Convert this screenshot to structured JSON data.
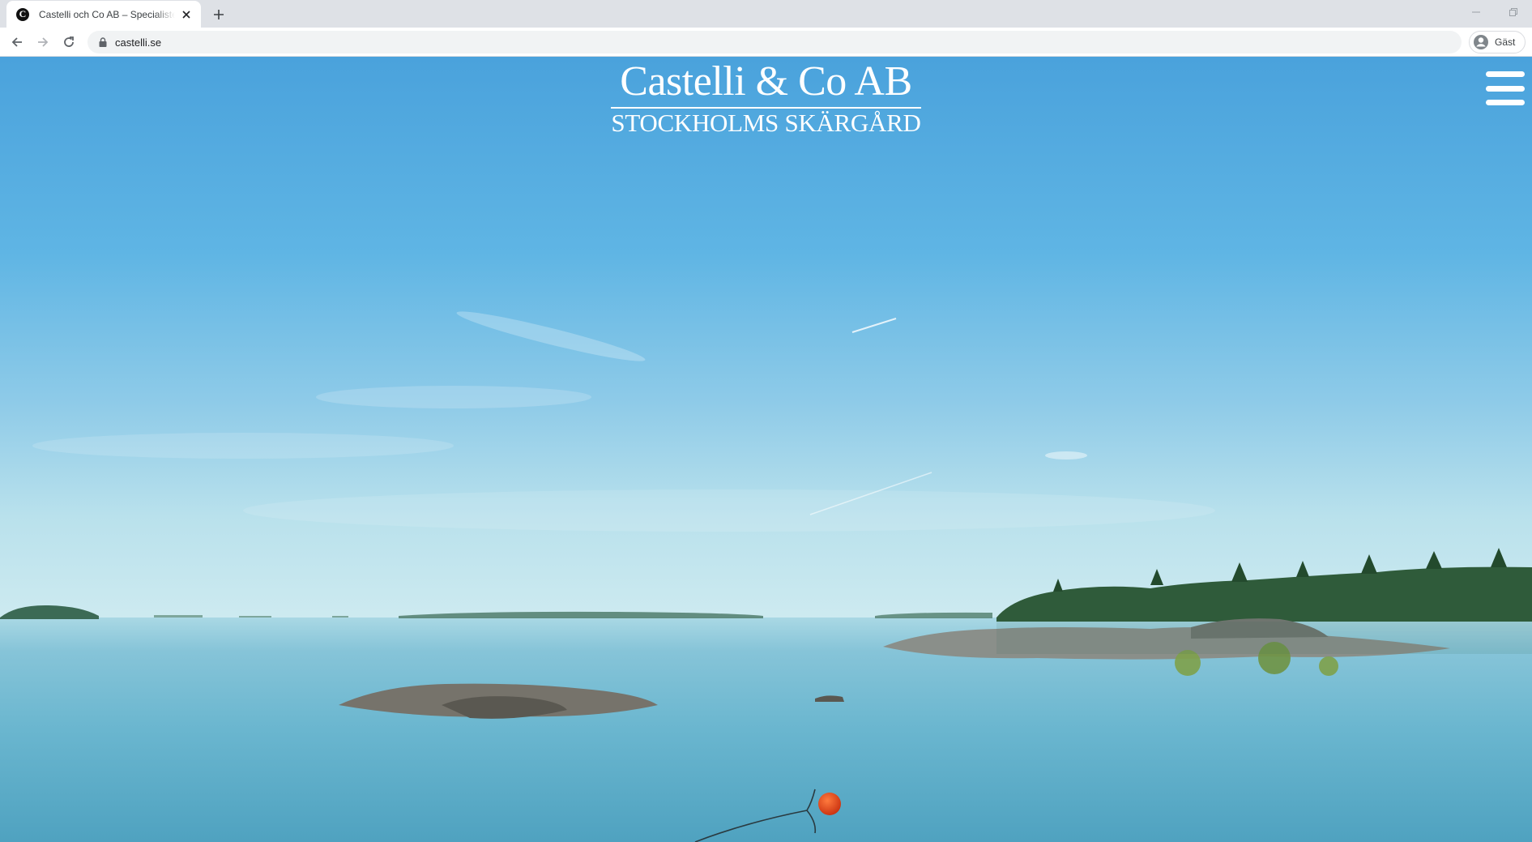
{
  "browser": {
    "tab_title": "Castelli och Co AB – Specialister på Stockholms skärgård",
    "favicon_letter": "C",
    "url": "castelli.se",
    "profile_label": "Gäst",
    "icons": {
      "close": "close-icon",
      "new_tab": "plus-icon",
      "minimize": "minimize-icon",
      "restore": "restore-icon",
      "back": "arrow-left-icon",
      "forward": "arrow-right-icon",
      "reload": "reload-icon",
      "lock": "lock-icon",
      "profile": "account-circle-icon"
    }
  },
  "page": {
    "logo_name": "Castelli & Co AB",
    "logo_subtitle": "STOCKHOLMS SKÄRGÅRD",
    "menu_icon": "hamburger-menu-icon",
    "hero_image": "archipelago-sea-landscape"
  },
  "colors": {
    "sky_top": "#4aa3db",
    "sky_horizon": "#bfe4ea",
    "water": "#5eaecb",
    "text_on_hero": "#ffffff"
  }
}
